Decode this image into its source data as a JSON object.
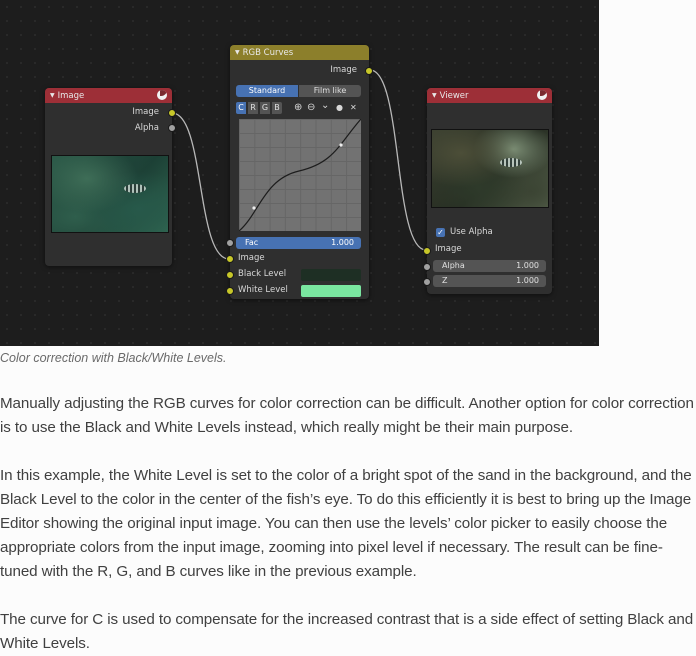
{
  "image_node": {
    "title": "Image",
    "outputs": [
      "Image",
      "Alpha"
    ]
  },
  "rgb_curves_node": {
    "title": "RGB Curves",
    "output_label": "Image",
    "modes": [
      "Standard",
      "Film like"
    ],
    "active_mode": "Standard",
    "channels": [
      "C",
      "R",
      "G",
      "B"
    ],
    "active_channel": "C",
    "tool_icons": [
      "zoom-in-icon",
      "zoom-out-icon",
      "chevron-down-icon",
      "dot-icon",
      "close-icon"
    ],
    "curve_glyphs": {
      "zoom_in": "⊕",
      "zoom_out": "⊖",
      "chevron": "⌄",
      "dot": "●",
      "close": "✕"
    },
    "fac_label": "Fac",
    "fac_value": "1.000",
    "inputs": [
      "Image",
      "Black Level",
      "White Level"
    ],
    "black_level_color": "#1e2f24",
    "white_level_color": "#7ae6a0"
  },
  "viewer_node": {
    "title": "Viewer",
    "use_alpha_label": "Use Alpha",
    "use_alpha_checked": true,
    "checkmark": "✓",
    "image_label": "Image",
    "alpha_label": "Alpha",
    "alpha_value": "1.000",
    "z_label": "Z",
    "z_value": "1.000"
  },
  "triangle_glyph": "▼",
  "caption": "Color correction with Black/White Levels.",
  "paragraphs": [
    "Manually adjusting the RGB curves for color correction can be difficult. Another option for color correction is to use the Black and White Levels instead, which really might be their main purpose.",
    "In this example, the White Level is set to the color of a bright spot of the sand in the background, and the Black Level to the color in the center of the fish’s eye. To do this efficiently it is best to bring up the Image Editor showing the original input image. You can then use the levels’ color picker to easily choose the appropriate colors from the input image, zooming into pixel level if necessary. The result can be fine-tuned with the R, G, and B curves like in the previous example.",
    "The curve for C is used to compensate for the increased contrast that is a side effect of setting Black and White Levels."
  ],
  "colors": {
    "editor_bg": "#1d1d1d",
    "node_bg": "#2f2f2f",
    "input_header": "#9d2f37",
    "color_header": "#8c7f2b",
    "accent_blue": "#4772b3",
    "socket_color": "#c7c729",
    "socket_gray": "#a1a1a1",
    "link": "#b8b8b8"
  }
}
